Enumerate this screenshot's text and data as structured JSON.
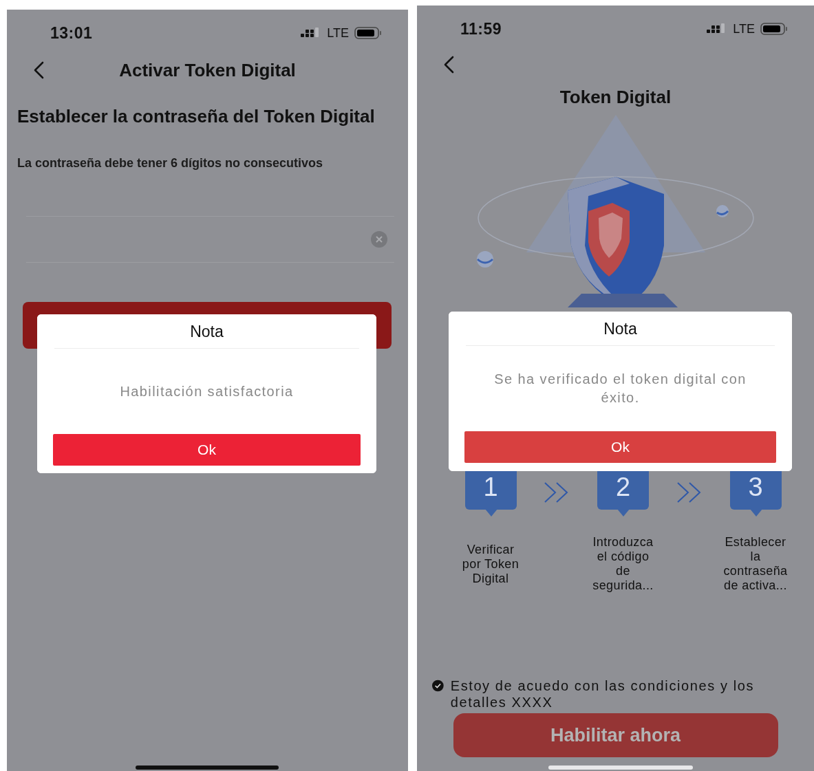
{
  "screens": [
    {
      "kind": "password",
      "status_bar": {
        "time": "13:01",
        "network": "LTE"
      },
      "nav": {
        "title": "Activar Token Digital"
      },
      "heading": "Establecer la contraseña del Token Digital",
      "hint": "La contraseña debe tener 6 dígitos no consecutivos",
      "dialog": {
        "title": "Nota",
        "message": "Habilitación satisfactoria",
        "button": "Ok"
      }
    },
    {
      "kind": "intro",
      "status_bar": {
        "time": "11:59",
        "network": "LTE"
      },
      "nav": {
        "title": "Token Digital"
      },
      "steps": [
        {
          "number": "1",
          "label": "Verificar por Token Digital"
        },
        {
          "number": "2",
          "label": "Introduzca el código de segurida..."
        },
        {
          "number": "3",
          "label": "Establecer la contraseña de activa..."
        }
      ],
      "agreement": {
        "checked": true,
        "text": "Estoy de acuedo con las condiciones y los detalles XXXX"
      },
      "primary_button": "Habilitar ahora",
      "dialog": {
        "title": "Nota",
        "message": "Se ha verificado el token digital con éxito.",
        "button": "Ok"
      }
    }
  ]
}
